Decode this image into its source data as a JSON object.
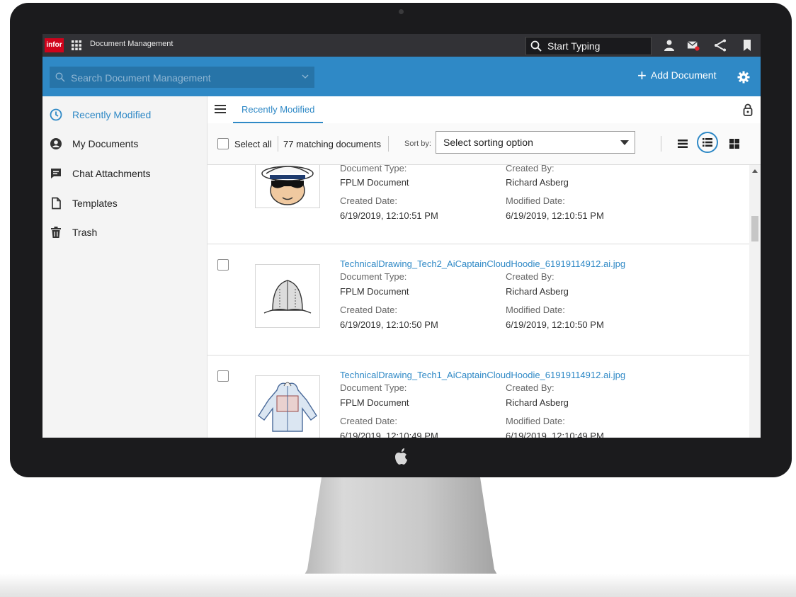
{
  "topbar": {
    "logo": "infor",
    "app_title": "Document Management",
    "search_placeholder": "Start Typing",
    "icons": [
      "apps-grid-icon",
      "user-icon",
      "mail-icon",
      "share-icon",
      "bookmark-icon"
    ]
  },
  "secondary_bar": {
    "search_placeholder": "Search Document Management",
    "add_document": "Add Document",
    "settings_icon": "gear-icon"
  },
  "sidebar": {
    "items": [
      {
        "label": "Recently Modified",
        "icon": "clock-icon",
        "active": true
      },
      {
        "label": "My Documents",
        "icon": "user-circle-icon",
        "active": false
      },
      {
        "label": "Chat Attachments",
        "icon": "chat-icon",
        "active": false
      },
      {
        "label": "Templates",
        "icon": "file-icon",
        "active": false
      },
      {
        "label": "Trash",
        "icon": "trash-icon",
        "active": false
      }
    ]
  },
  "content": {
    "tab": "Recently Modified",
    "toolbar": {
      "select_all": "Select all",
      "matching": "77 matching documents",
      "sort_by": "Sort by:",
      "sort_value": "Select sorting option"
    },
    "labels": {
      "doc_type": "Document Type:",
      "created_by": "Created By:",
      "created_date": "Created Date:",
      "modified_date": "Modified Date:"
    },
    "documents": [
      {
        "name": "",
        "doc_type": "FPLM Document",
        "created_by": "Richard Asberg",
        "created_date": "6/19/2019, 12:10:51 PM",
        "modified_date": "6/19/2019, 12:10:51 PM",
        "thumbnail": "captain-cartoon"
      },
      {
        "name": "TechnicalDrawing_Tech2_AiCaptainCloudHoodie_61919114912.ai.jpg",
        "doc_type": "FPLM Document",
        "created_by": "Richard Asberg",
        "created_date": "6/19/2019, 12:10:50 PM",
        "modified_date": "6/19/2019, 12:10:50 PM",
        "thumbnail": "hood-drawing"
      },
      {
        "name": "TechnicalDrawing_Tech1_AiCaptainCloudHoodie_61919114912.ai.jpg",
        "doc_type": "FPLM Document",
        "created_by": "Richard Asberg",
        "created_date": "6/19/2019, 12:10:49 PM",
        "modified_date": "6/19/2019, 12:10:49 PM",
        "thumbnail": "hoodie-drawing"
      }
    ]
  },
  "colors": {
    "accent": "#2f89c6",
    "topbar": "#323236",
    "logo": "#d0021b",
    "bezel": "#1b1b1d"
  }
}
